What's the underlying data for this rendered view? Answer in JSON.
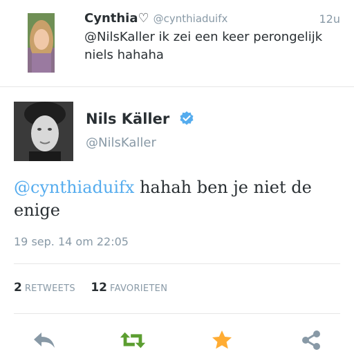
{
  "reply_tweet": {
    "name": "Cynthia♡",
    "handle": "@cynthiaduifx",
    "time": "12u",
    "text": "@NilsKaller ik zei een keer perongelijk niels hahaha"
  },
  "main_tweet": {
    "name": "Nils Käller",
    "handle": "@NilsKaller",
    "mention": "@cynthiaduifx",
    "text": " hahah ben je niet de enige",
    "date": "19 sep. 14 om 22:05"
  },
  "stats": {
    "retweets_count": "2",
    "retweets_label": "RETWEETS",
    "favorites_count": "12",
    "favorites_label": "FAVORIETEN"
  },
  "actions": {
    "reply_icon": "reply-icon",
    "retweet_icon": "retweet-icon",
    "favorite_icon": "star-icon",
    "share_icon": "share-icon"
  },
  "colors": {
    "link": "#55acee",
    "retweet": "#5c9e31",
    "favorite": "#ffac33",
    "muted": "#8899a6",
    "verified": "#55acee"
  }
}
